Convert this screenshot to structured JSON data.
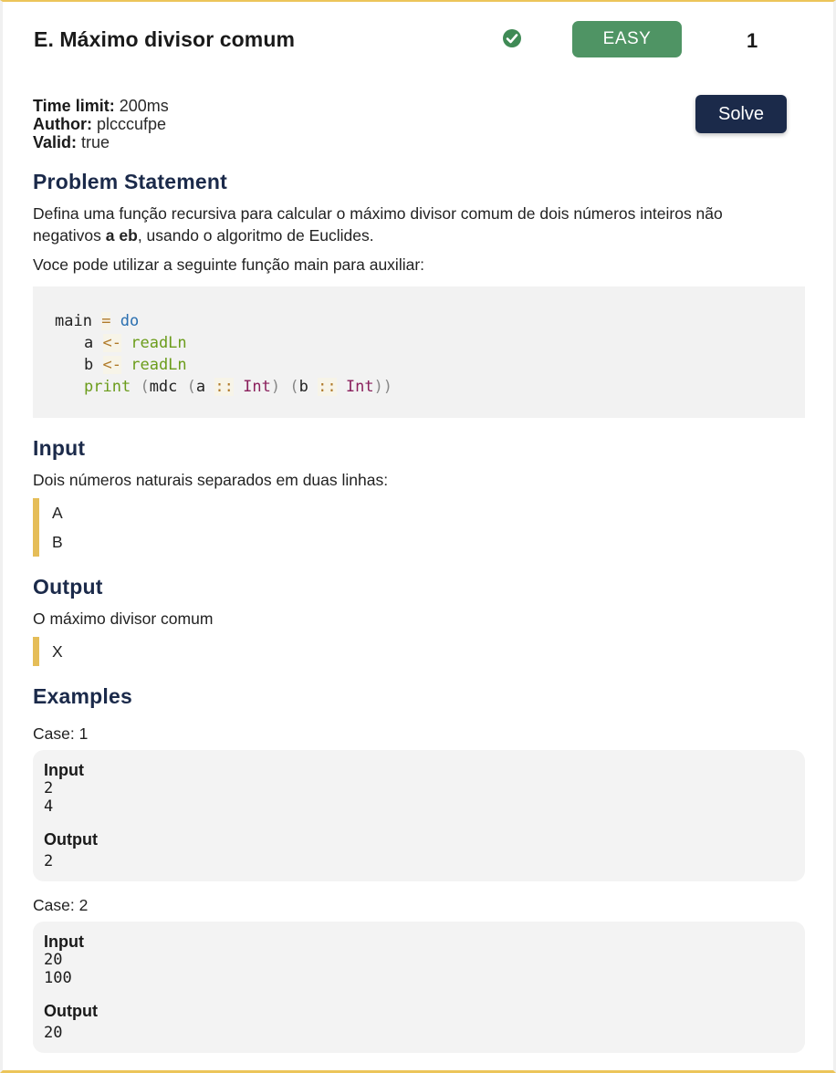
{
  "header": {
    "title": "E. Máximo divisor comum",
    "difficulty": "EASY",
    "count": "1",
    "solved_icon": "check-circle-icon",
    "colors": {
      "accent_border": "#ecc55a",
      "badge_bg": "#4f9464",
      "button_bg": "#1b2a4a",
      "heading": "#1b2a4a"
    }
  },
  "meta": {
    "time_limit_label": "Time limit:",
    "time_limit_value": "200ms",
    "author_label": "Author:",
    "author_value": "plcccufpe",
    "valid_label": "Valid:",
    "valid_value": "true"
  },
  "solve_button": "Solve",
  "statement": {
    "heading": "Problem Statement",
    "text_before": "Defina uma função recursiva para calcular o máximo divisor comum de dois números inteiros não negativos ",
    "text_bold": "a eb",
    "text_after": ", usando o algoritmo de Euclides.",
    "helper_text": "Voce pode utilizar a seguinte função main para auxiliar:",
    "code": {
      "l1_name": "main",
      "l1_eq": "=",
      "l1_do": "do",
      "l2_var": "a",
      "l2_arrow": "<-",
      "l2_fn": "readLn",
      "l3_var": "b",
      "l3_arrow": "<-",
      "l3_fn": "readLn",
      "l4_fn": "print",
      "l4_open1": "(",
      "l4_mdc": "mdc",
      "l4_open2": "(",
      "l4_a": "a",
      "l4_dc1": "::",
      "l4_int1": "Int",
      "l4_close2": ")",
      "l4_open3": "(",
      "l4_b": "b",
      "l4_dc2": "::",
      "l4_int2": "Int",
      "l4_close3": "))"
    }
  },
  "input_section": {
    "heading": "Input",
    "text": "Dois números naturais separados em duas linhas:",
    "lines": [
      "A",
      "B"
    ]
  },
  "output_section": {
    "heading": "Output",
    "text": "O máximo divisor comum",
    "lines": [
      "X"
    ]
  },
  "examples": {
    "heading": "Examples",
    "cases": [
      {
        "label": "Case: 1",
        "input_label": "Input",
        "input_lines": [
          "2",
          "4"
        ],
        "output_label": "Output",
        "output": "2"
      },
      {
        "label": "Case: 2",
        "input_label": "Input",
        "input_lines": [
          "20",
          "100"
        ],
        "output_label": "Output",
        "output": "20"
      }
    ]
  }
}
